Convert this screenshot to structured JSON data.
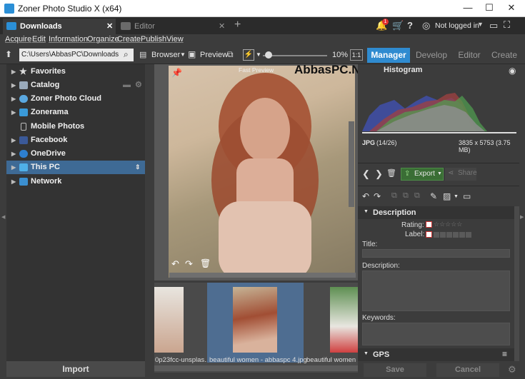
{
  "window": {
    "title": "Zoner Photo Studio X (x64)",
    "minimize": "—",
    "maximize": "☐",
    "close": "✕"
  },
  "tabs": [
    {
      "label": "Downloads"
    },
    {
      "label": "Editor"
    }
  ],
  "tab_close": "✕",
  "tab_add": "+",
  "header": {
    "account": "Not logged in",
    "notif_count": "1"
  },
  "menu": [
    "Acquire",
    "Edit",
    "Information",
    "Organize",
    "Create",
    "Publish",
    "View"
  ],
  "toolbar": {
    "path": "C:\\Users\\AbbasPC\\Downloads",
    "browser": "Browser",
    "preview": "Preview",
    "zoom": "10%",
    "ratio": "1:1"
  },
  "modules": [
    "Manager",
    "Develop",
    "Editor",
    "Create"
  ],
  "nav": [
    {
      "label": "Favorites"
    },
    {
      "label": "Catalog"
    },
    {
      "label": "Zoner Photo Cloud"
    },
    {
      "label": "Zonerama"
    },
    {
      "label": "Mobile Photos"
    },
    {
      "label": "Facebook"
    },
    {
      "label": "OneDrive"
    },
    {
      "label": "This PC"
    },
    {
      "label": "Network"
    }
  ],
  "import_label": "Import",
  "preview": {
    "caption": "Fast Preview",
    "watermark": "AbbasPC.Net"
  },
  "thumbs": [
    {
      "caption": "0p23fcc-unsplas..."
    },
    {
      "caption": "beautiful women - abbaspc 4.jpg"
    },
    {
      "caption": "beautiful women - ..."
    }
  ],
  "histogram": {
    "title": "Histogram",
    "format": "JPG",
    "index": "(14/26)",
    "dims": "3835 x 5753 (3.75 MB)"
  },
  "actions": {
    "export": "Export",
    "share": "Share"
  },
  "description": {
    "title": "Description",
    "rating_label": "Rating:",
    "label_label": "Label:",
    "title_label": "Title:",
    "desc_label": "Description:",
    "keywords_label": "Keywords:",
    "gps_label": "GPS"
  },
  "label_colors": [
    "#e05050",
    "#d8c040",
    "#60a050",
    "#4a78c0",
    "#9050b0",
    "#808080"
  ],
  "bottom": {
    "save": "Save",
    "cancel": "Cancel"
  }
}
